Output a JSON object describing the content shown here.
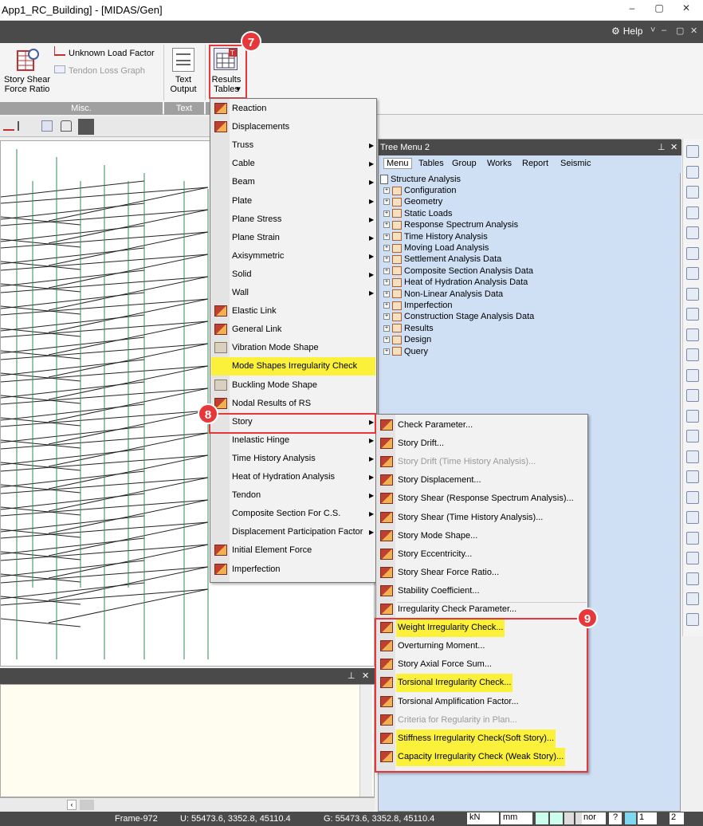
{
  "window": {
    "title": "App1_RC_Building] - [MIDAS/Gen]",
    "min": "–",
    "restore": "▢",
    "close": "✕"
  },
  "helpbar": {
    "help_label": "Help",
    "help_caret": "˅",
    "ctrl_min": "–",
    "ctrl_restore": "▢",
    "ctrl_close": "✕"
  },
  "ribbon": {
    "story_shear": "Story Shear\nForce Ratio",
    "unknown_load": "Unknown Load Factor",
    "tendon_loss": "Tendon Loss Graph",
    "text_output": "Text\nOutput",
    "results_tables": "Results\nTables",
    "results_caret": "▾",
    "group_misc": "Misc.",
    "group_text": "Text"
  },
  "tree": {
    "title": "Tree Menu 2",
    "pin": "⊥",
    "close": "✕",
    "tabs": [
      "Menu",
      "Tables",
      "Group",
      "Works",
      "Report",
      "Seismic"
    ],
    "root": "Structure Analysis",
    "nodes": [
      "Configuration",
      "Geometry",
      "Static Loads",
      "Response Spectrum Analysis",
      "Time History Analysis",
      "Moving Load Analysis",
      "Settlement Analysis Data",
      "Composite Section Analysis Data",
      "Heat of Hydration Analysis Data",
      "Non-Linear Analysis Data",
      "Imperfection",
      "Construction Stage Analysis Data",
      "Results",
      "Design",
      "Query"
    ]
  },
  "menu1": {
    "items": [
      {
        "label": "Reaction",
        "arrow": false,
        "icon": "t"
      },
      {
        "label": "Displacements",
        "arrow": false,
        "icon": "t"
      },
      {
        "label": "Truss",
        "arrow": true,
        "icon": ""
      },
      {
        "label": "Cable",
        "arrow": true,
        "icon": ""
      },
      {
        "label": "Beam",
        "arrow": true,
        "icon": ""
      },
      {
        "label": "Plate",
        "arrow": true,
        "icon": ""
      },
      {
        "label": "Plane Stress",
        "arrow": true,
        "icon": ""
      },
      {
        "label": "Plane Strain",
        "arrow": true,
        "icon": ""
      },
      {
        "label": "Axisymmetric",
        "arrow": true,
        "icon": ""
      },
      {
        "label": "Solid",
        "arrow": true,
        "icon": ""
      },
      {
        "label": "Wall",
        "arrow": true,
        "icon": ""
      },
      {
        "label": "Elastic Link",
        "arrow": false,
        "icon": "t"
      },
      {
        "label": "General Link",
        "arrow": false,
        "icon": "t"
      },
      {
        "label": "Vibration Mode Shape",
        "arrow": false,
        "icon": "g"
      },
      {
        "label": "Mode Shapes Irregularity Check",
        "arrow": false,
        "icon": "",
        "hl": true
      },
      {
        "label": "Buckling Mode Shape",
        "arrow": false,
        "icon": "g"
      },
      {
        "label": "Nodal Results of RS",
        "arrow": false,
        "icon": "t"
      },
      {
        "label": "Story",
        "arrow": true,
        "icon": ""
      },
      {
        "label": "Inelastic Hinge",
        "arrow": true,
        "icon": ""
      },
      {
        "label": "Time History Analysis",
        "arrow": true,
        "icon": ""
      },
      {
        "label": "Heat of Hydration Analysis",
        "arrow": true,
        "icon": ""
      },
      {
        "label": "Tendon",
        "arrow": true,
        "icon": ""
      },
      {
        "label": "Composite Section For C.S.",
        "arrow": true,
        "icon": ""
      },
      {
        "label": "Displacement Participation Factor",
        "arrow": true,
        "icon": ""
      },
      {
        "label": "Initial Element Force",
        "arrow": false,
        "icon": "t"
      },
      {
        "label": "Imperfection",
        "arrow": false,
        "icon": "t"
      }
    ]
  },
  "menu2": {
    "items": [
      {
        "label": "Check Parameter...",
        "dis": false,
        "hl": false
      },
      {
        "label": "Story Drift...",
        "dis": false,
        "hl": false
      },
      {
        "label": "Story Drift (Time History Analysis)...",
        "dis": true,
        "hl": false
      },
      {
        "label": "Story Displacement...",
        "dis": false,
        "hl": false
      },
      {
        "label": "Story Shear (Response Spectrum Analysis)...",
        "dis": false,
        "hl": false
      },
      {
        "label": "Story Shear (Time History Analysis)...",
        "dis": false,
        "hl": false
      },
      {
        "label": "Story Mode Shape...",
        "dis": false,
        "hl": false
      },
      {
        "label": "Story Eccentricity...",
        "dis": false,
        "hl": false
      },
      {
        "label": "Story Shear Force Ratio...",
        "dis": false,
        "hl": false
      },
      {
        "label": "Stability Coefficient...",
        "dis": false,
        "hl": false
      },
      {
        "label": "Irregularity Check Parameter...",
        "dis": false,
        "hl": false
      },
      {
        "label": "Weight Irregularity Check...",
        "dis": false,
        "hl": true
      },
      {
        "label": "Overturning Moment...",
        "dis": false,
        "hl": false
      },
      {
        "label": "Story Axial Force Sum...",
        "dis": false,
        "hl": false
      },
      {
        "label": "Torsional Irregularity Check...",
        "dis": false,
        "hl": true
      },
      {
        "label": "Torsional Amplification Factor...",
        "dis": false,
        "hl": false
      },
      {
        "label": "Criteria for Regularity in Plan...",
        "dis": true,
        "hl": false
      },
      {
        "label": "Stiffness Irregularity Check(Soft Story)...",
        "dis": false,
        "hl": true
      },
      {
        "label": "Capacity Irregularity Check (Weak Story)...",
        "dis": false,
        "hl": true
      }
    ]
  },
  "annotations": {
    "a7": "7",
    "a8": "8",
    "a9": "9"
  },
  "output": {
    "pin": "⊥",
    "close": "✕"
  },
  "status": {
    "frame": "Frame-972",
    "u": "U: 55473.6, 3352.8, 45110.4",
    "g": "G: 55473.6, 3352.8, 45110.4",
    "force_unit": "kN",
    "length_unit": "mm",
    "extra": "nor",
    "page": "1",
    "page2": "2"
  },
  "colors": {
    "accent_red": "#e8373a",
    "highlight": "#fbf13a",
    "tree_bg": "#cfe0f5",
    "frame_green": "#2e8b57"
  }
}
